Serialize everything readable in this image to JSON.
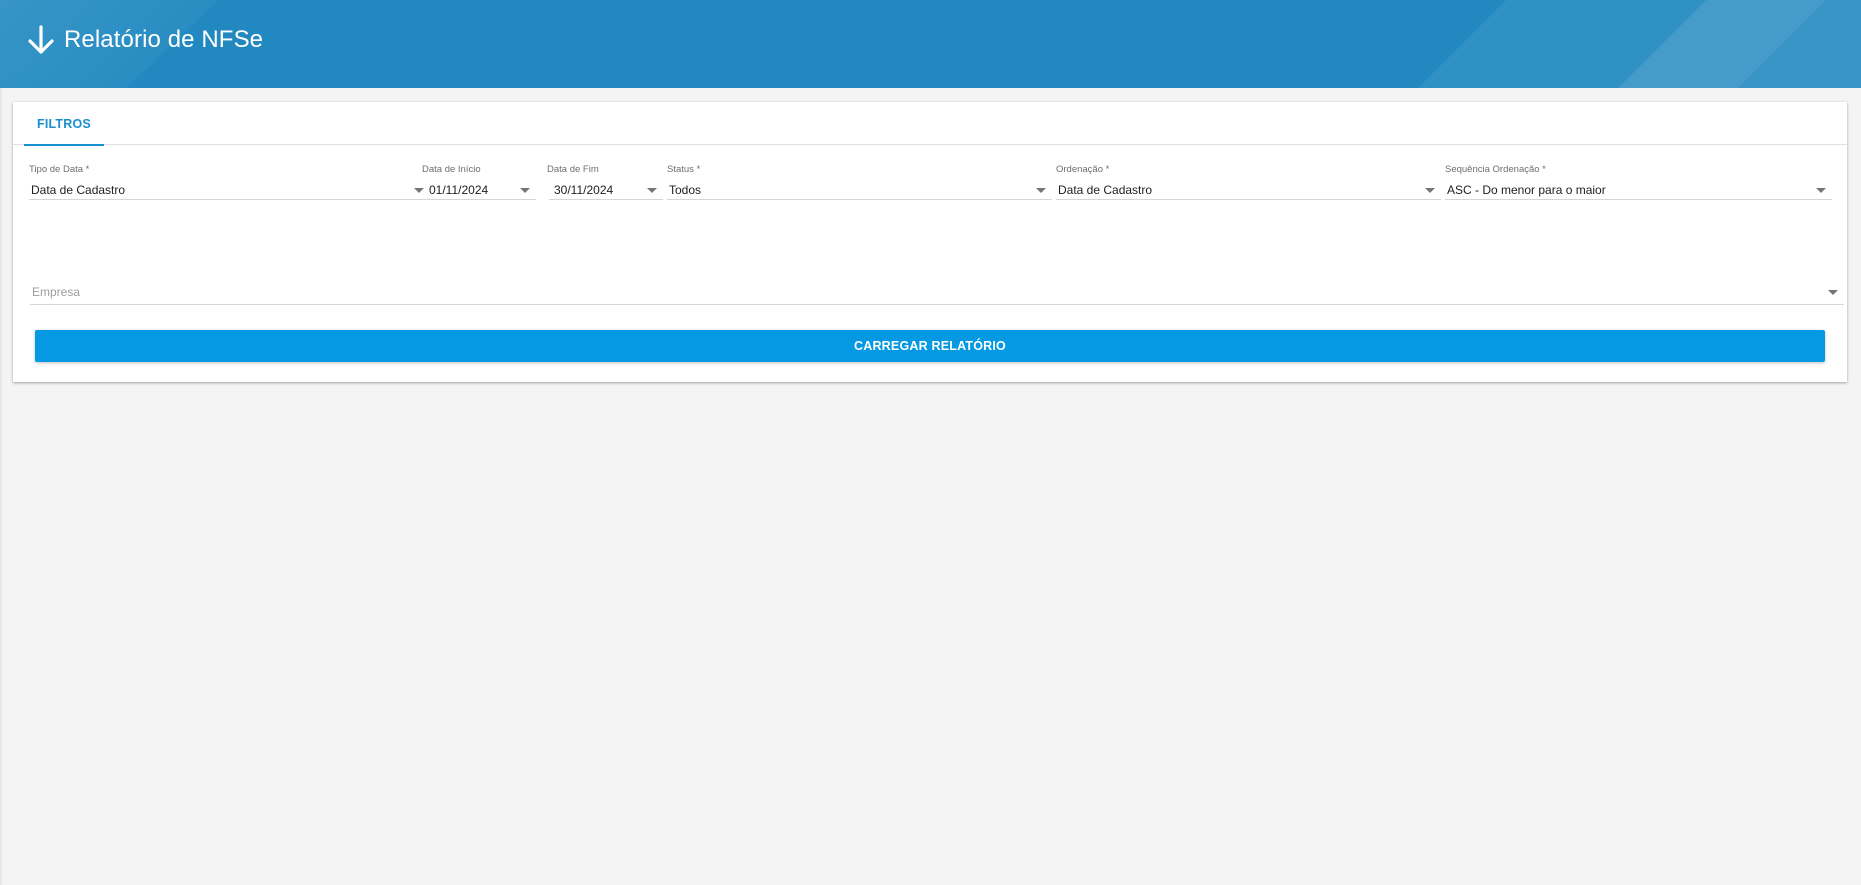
{
  "header": {
    "icon": "arrow-down-icon",
    "title": "Relatório de NFSe",
    "bg_color": "#2189c0"
  },
  "tabs": [
    {
      "label": "FILTROS",
      "active": true
    }
  ],
  "filters": {
    "tipo_data": {
      "label": "Tipo de Data *",
      "value": "Data de Cadastro"
    },
    "data_inicio": {
      "label": "Data de Início",
      "value": "01/11/2024"
    },
    "data_fim": {
      "label": "Data de Fim",
      "value": "30/11/2024"
    },
    "status": {
      "label": "Status *",
      "value": "Todos"
    },
    "ordenacao": {
      "label": "Ordenação *",
      "value": "Data de Cadastro"
    },
    "sequencia": {
      "label": "Sequência Ordenação *",
      "value": "ASC - Do menor para o maior"
    }
  },
  "empresa": {
    "placeholder": "Empresa"
  },
  "actions": {
    "load_label": "CARREGAR RELATÓRIO",
    "accent_color": "#0599e4"
  }
}
